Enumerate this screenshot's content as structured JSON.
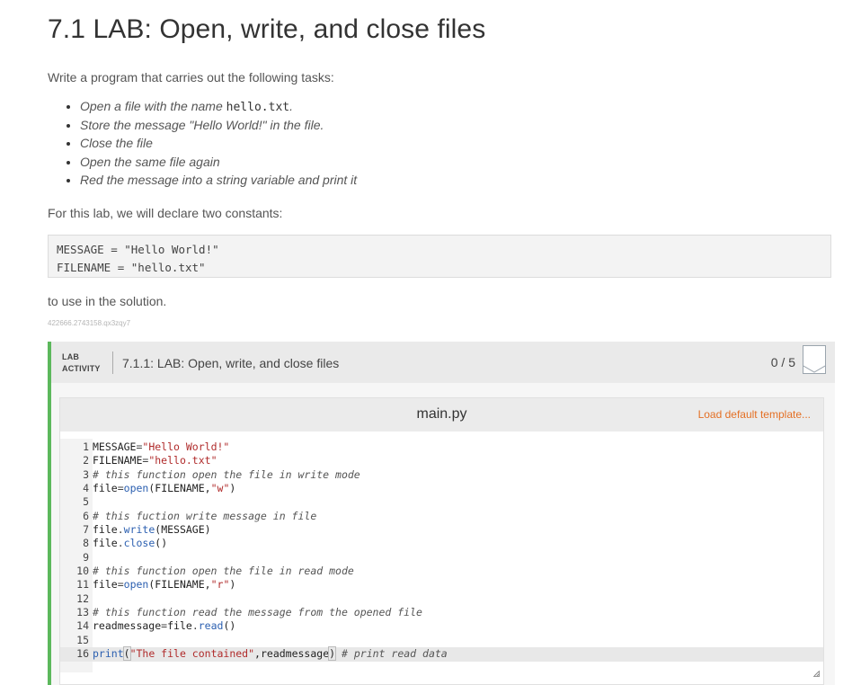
{
  "page": {
    "title": "7.1 LAB: Open, write, and close files",
    "intro": "Write a program that carries out the following tasks:",
    "tasks": {
      "t1_prefix": "Open a file with the name ",
      "t1_code": "hello.txt",
      "t1_suffix": ".",
      "t2": "Store the message \"Hello World!\" in the file.",
      "t3": "Close the file",
      "t4": "Open the same file again",
      "t5": "Red the message into a string variable and print it"
    },
    "constants_intro": "For this lab, we will declare two constants:",
    "constants_code": [
      "MESSAGE = \"Hello World!\"",
      "FILENAME = \"hello.txt\""
    ],
    "after_text": "to use in the solution.",
    "tiny_id": "422666.2743158.qx3zqy7"
  },
  "lab": {
    "badge_line1": "LAB",
    "badge_line2": "ACTIVITY",
    "title": "7.1.1: LAB: Open, write, and close files",
    "score": "0 / 5",
    "accent_color": "#5cb85c"
  },
  "editor": {
    "file_name": "main.py",
    "load_template": "Load default template...",
    "line_numbers": [
      "1",
      "2",
      "3",
      "4",
      "5",
      "6",
      "7",
      "8",
      "9",
      "10",
      "11",
      "12",
      "13",
      "14",
      "15",
      "16"
    ],
    "lines": {
      "l1": {
        "a": "MESSAGE",
        "b": "=",
        "c": "\"Hello World!\""
      },
      "l2": {
        "a": "FILENAME",
        "b": "=",
        "c": "\"hello.txt\""
      },
      "l3": {
        "comment": "# this function open the file in write mode"
      },
      "l4": {
        "a": "file",
        "b": "=",
        "c": "open",
        "d": "(FILENAME,",
        "e": "\"w\"",
        "f": ")"
      },
      "l6": {
        "comment": "# this fuction write message in file"
      },
      "l7": {
        "a": "file",
        "b": ".",
        "c": "write",
        "d": "(MESSAGE)"
      },
      "l8": {
        "a": "file",
        "b": ".",
        "c": "close",
        "d": "()"
      },
      "l10": {
        "comment": "# this function open the file in read mode"
      },
      "l11": {
        "a": "file",
        "b": "=",
        "c": "open",
        "d": "(FILENAME,",
        "e": "\"r\"",
        "f": ")"
      },
      "l13": {
        "comment": "# this function read the message from the opened file"
      },
      "l14": {
        "a": "readmessage",
        "b": "=",
        "c": "file",
        "d": ".",
        "e": "read",
        "f": "()"
      },
      "l16": {
        "a": "print",
        "b": "(",
        "c": "\"The file contained\"",
        "d": ",readmessage",
        "e": ")",
        "f": " ",
        "g": "# print read data"
      }
    }
  }
}
